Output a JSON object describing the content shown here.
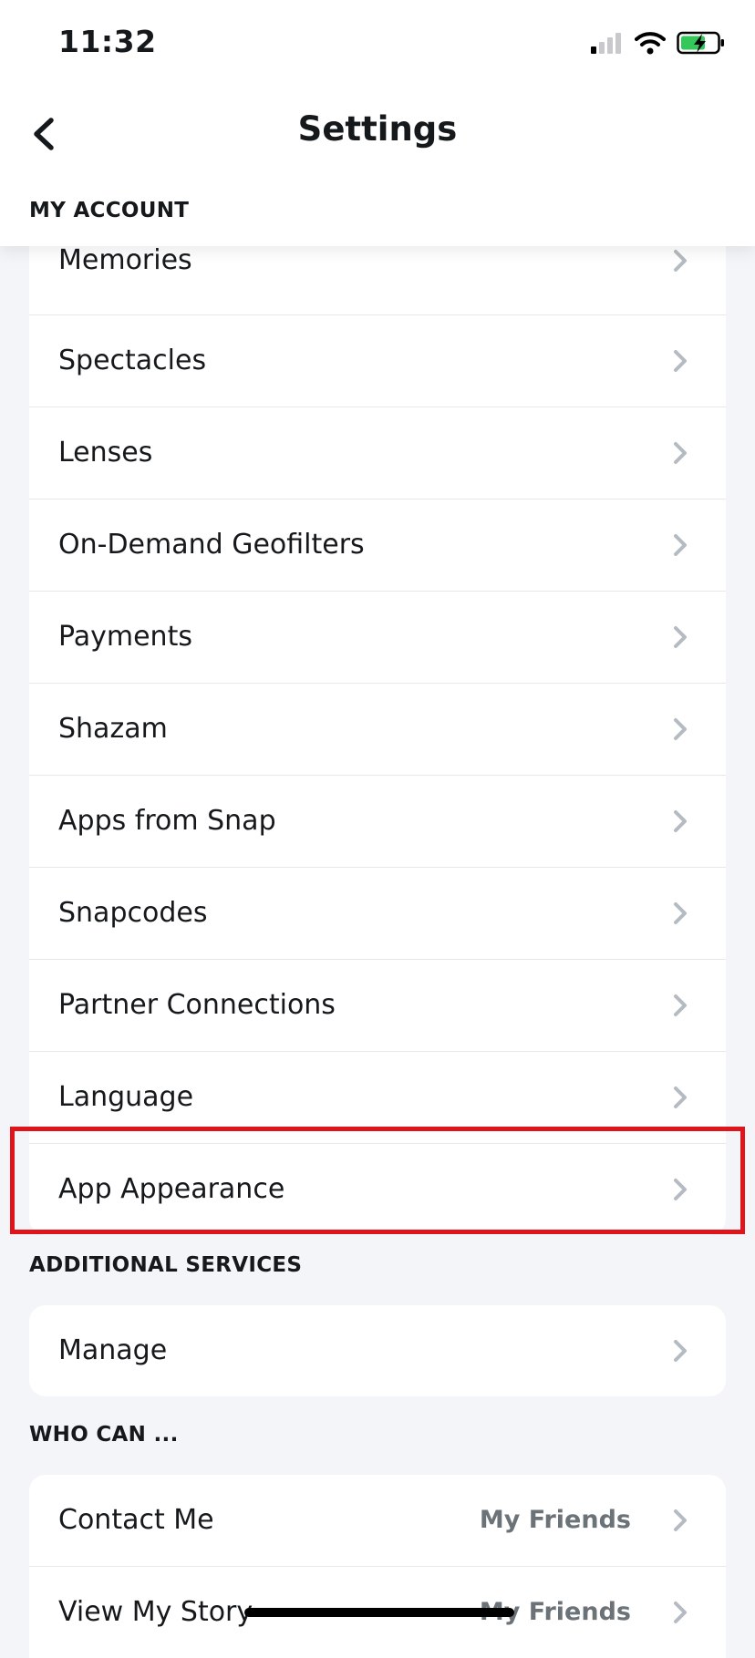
{
  "status": {
    "time": "11:32"
  },
  "header": {
    "title": "Settings"
  },
  "sections": {
    "my_account": {
      "label": "MY ACCOUNT",
      "items": [
        {
          "label": "Memories"
        },
        {
          "label": "Spectacles"
        },
        {
          "label": "Lenses"
        },
        {
          "label": "On-Demand Geofilters"
        },
        {
          "label": "Payments"
        },
        {
          "label": "Shazam"
        },
        {
          "label": "Apps from Snap"
        },
        {
          "label": "Snapcodes"
        },
        {
          "label": "Partner Connections"
        },
        {
          "label": "Language"
        },
        {
          "label": "App Appearance"
        }
      ]
    },
    "additional_services": {
      "label": "ADDITIONAL SERVICES",
      "items": [
        {
          "label": "Manage"
        }
      ]
    },
    "who_can": {
      "label": "WHO CAN ...",
      "items": [
        {
          "label": "Contact Me",
          "value": "My Friends"
        },
        {
          "label": "View My Story",
          "value": "My Friends"
        }
      ]
    }
  },
  "colors": {
    "highlight": "#e0141b",
    "background": "#f3f5f8",
    "chevron": "#b5bbc2",
    "battery": "#34c759"
  }
}
